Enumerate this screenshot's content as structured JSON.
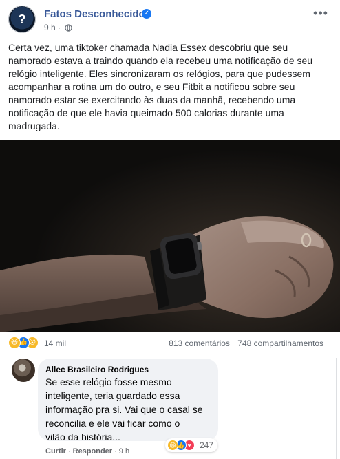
{
  "post": {
    "page_name": "Fatos Desconhecidos",
    "time": "9 h",
    "separator": " · ",
    "text": "Certa vez, uma tiktoker chamada Nadia Essex descobriu que seu\nnamorado estava a traindo quando ela recebeu uma notificação de seu\nrelógio inteligente. Eles sincronizaram os relógios, para que pudessem\nacompanhar a rotina um do outro, e seu Fitbit a notificou sobre seu\nnamorado estar se exercitando às duas da manhã, recebendo uma\nnotificação de que ele havia queimado 500 calorias durante uma\nmadrugada.",
    "icons": {
      "verified": "verified-badge-icon",
      "privacy": "globe-icon",
      "more": "more-options-icon"
    }
  },
  "reactions": {
    "count": "14 mil",
    "comments": "813 comentários",
    "shares": "748 compartilhamentos",
    "types": [
      "haha",
      "like",
      "love",
      "wow"
    ]
  },
  "comment": {
    "author": "Allec Brasileiro Rodrigues",
    "text": "Se esse relógio fosse mesmo\ninteligente, teria guardado essa\ninformação pra si. Vai que o casal se\nreconcilia e ele vai ficar como o\nvilão da história...",
    "reaction_count": "247",
    "reaction_types": [
      "haha",
      "like",
      "love"
    ],
    "actions": {
      "like": "Curtir",
      "reply": "Responder",
      "time": "9 h",
      "separator": "·"
    }
  },
  "colors": {
    "page_name": "#385898",
    "like_blue": "#1877f2",
    "love_red": "#f33e58",
    "haha_yellow": "#f7b928",
    "bubble_bg": "#f0f2f5",
    "secondary_text": "#606770"
  }
}
